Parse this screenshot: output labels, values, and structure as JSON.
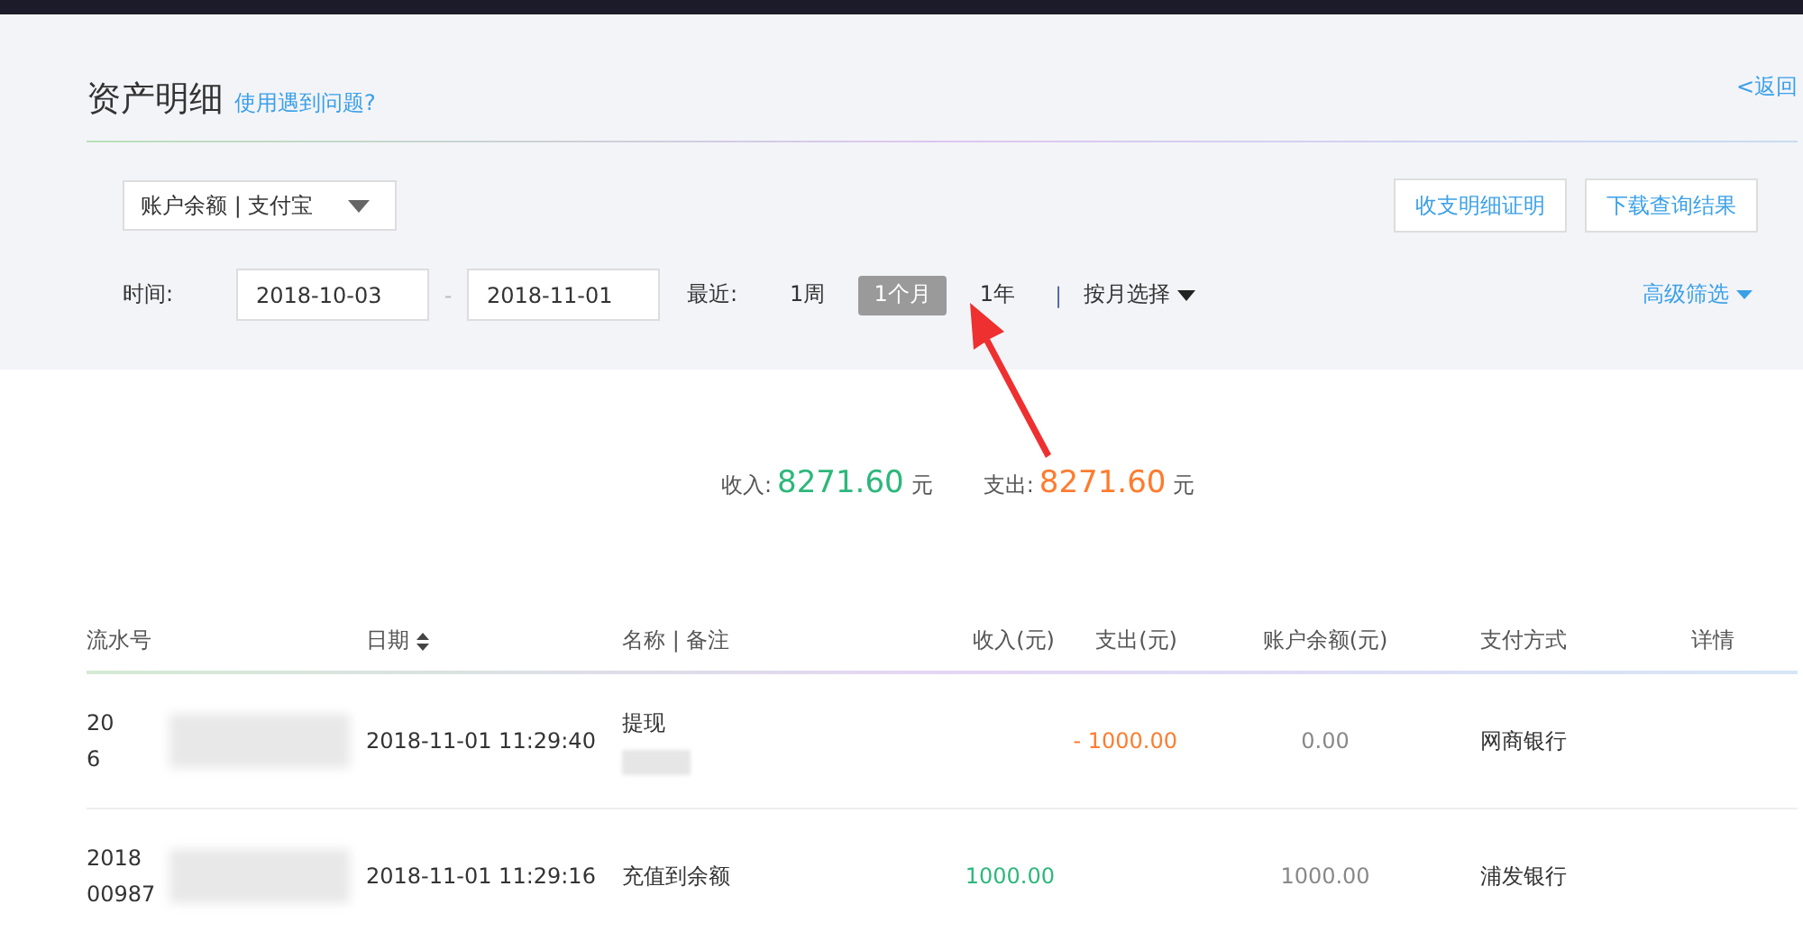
{
  "header": {
    "title": "资产明细",
    "help_link": "使用遇到问题?",
    "back_link": "<返回"
  },
  "filter": {
    "account": "账户余额 | 支付宝",
    "buttons": [
      "收支明细证明",
      "下载查询结果"
    ],
    "time_label": "时间:",
    "start_date": "2018-10-03",
    "separator": "-",
    "end_date": "2018-11-01",
    "recent_label": "最近:",
    "periods": [
      {
        "label": "1周",
        "selected": false
      },
      {
        "label": "1个月",
        "selected": true
      },
      {
        "label": "1年",
        "selected": false
      }
    ],
    "divider": "|",
    "month_select": "按月选择",
    "advanced": "高级筛选"
  },
  "summary": {
    "income_label": "收入:",
    "income": "8271.60",
    "income_unit": "元",
    "expense_label": "支出:",
    "expense": "8271.60",
    "expense_unit": "元"
  },
  "table": {
    "columns": [
      "流水号",
      "日期",
      "名称 | 备注",
      "收入(元)",
      "支出(元)",
      "账户余额(元)",
      "支付方式",
      "详情"
    ],
    "rows": [
      {
        "serial": [
          "20",
          "6"
        ],
        "date": "2018-11-01 11:29:40",
        "name": "提现",
        "income": "",
        "expense": "- 1000.00",
        "balance": "0.00",
        "method": "网商银行"
      },
      {
        "serial": [
          "2018",
          "00987"
        ],
        "date": "2018-11-01 11:29:16",
        "name": "充值到余额",
        "income": "1000.00",
        "expense": "",
        "balance": "1000.00",
        "method": "浦发银行"
      }
    ]
  }
}
